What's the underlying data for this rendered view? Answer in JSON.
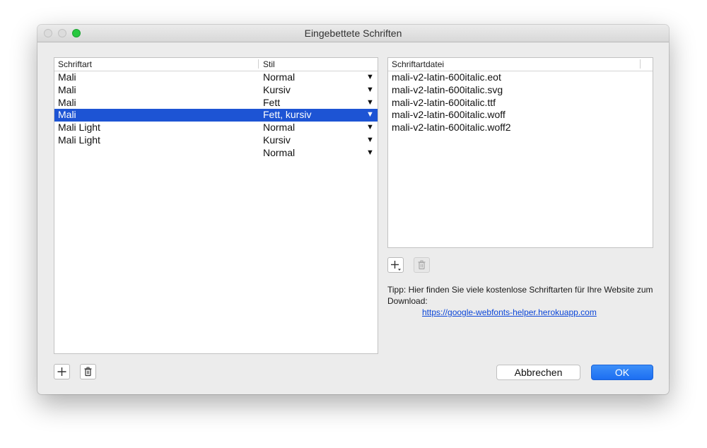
{
  "window": {
    "title": "Eingebettete Schriften"
  },
  "fonts_table": {
    "col_font": "Schriftart",
    "col_style": "Stil",
    "rows": [
      {
        "font": "Mali",
        "style": "Normal"
      },
      {
        "font": "Mali",
        "style": "Kursiv"
      },
      {
        "font": "Mali",
        "style": "Fett"
      },
      {
        "font": "Mali",
        "style": "Fett, kursiv",
        "selected": true
      },
      {
        "font": "Mali Light",
        "style": "Normal"
      },
      {
        "font": "Mali Light",
        "style": "Kursiv"
      },
      {
        "font": "",
        "style": "Normal"
      }
    ],
    "dropdown_glyph": "▼"
  },
  "files_table": {
    "col_file": "Schriftartdatei",
    "rows": [
      "mali-v2-latin-600italic.eot",
      "mali-v2-latin-600italic.svg",
      "mali-v2-latin-600italic.ttf",
      "mali-v2-latin-600italic.woff",
      "mali-v2-latin-600italic.woff2"
    ]
  },
  "tip": {
    "text": "Tipp: Hier finden Sie viele kostenlose Schriftarten für Ihre Website zum Download:",
    "link": "https://google-webfonts-helper.herokuapp.com"
  },
  "buttons": {
    "cancel": "Abbrechen",
    "ok": "OK"
  },
  "colors": {
    "selection": "#1d54d4",
    "ok_button": "#1c6ef2",
    "link": "#0b46d8",
    "zoom_light": "#28c840"
  },
  "icons": {
    "add": "plus-icon",
    "add_menu": "plus-dropdown-icon",
    "delete": "trash-icon"
  }
}
